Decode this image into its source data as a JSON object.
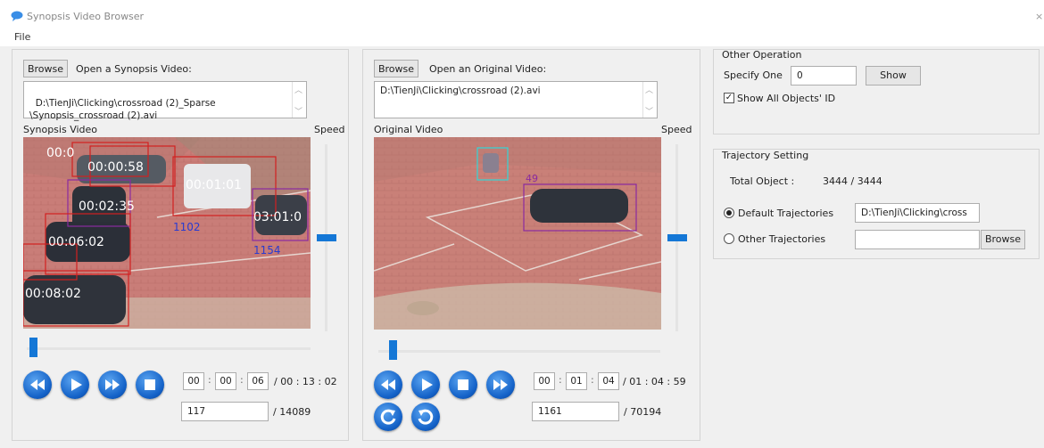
{
  "window": {
    "title": "Synopsis Video Browser",
    "close": "×"
  },
  "menu": {
    "file": "File"
  },
  "synopsis": {
    "browse_label": "Browse",
    "open_label": "Open a Synopsis Video:",
    "path": "D:\\TienJi\\Clicking\\crossroad (2)_Sparse\n\\Synopsis_crossroad (2).avi",
    "video_label": "Synopsis Video",
    "speed_label": "Speed",
    "speed_level": 0.5,
    "seek_fraction": 0.01,
    "time": {
      "hh": "00",
      "mm": "00",
      "ss": "06",
      "total": "/ 00 : 13 : 02"
    },
    "frame": {
      "current": "117",
      "total": "/ 14089"
    },
    "overlays": [
      {
        "text": "00:0",
        "color": "#ffffff"
      },
      {
        "text": "00:00:58",
        "color": "#ffffff"
      },
      {
        "text": "00:01:01",
        "color": "#ffffff"
      },
      {
        "text": "00:02:35",
        "color": "#ffffff"
      },
      {
        "text": "00:06:02",
        "color": "#ffffff"
      },
      {
        "text": "00:08:02",
        "color": "#ffffff"
      },
      {
        "text": "03:01:0",
        "color": "#ffffff"
      },
      {
        "text": "1102",
        "color": "#2a3bd0"
      },
      {
        "text": "1154",
        "color": "#2a3bd0"
      }
    ]
  },
  "original": {
    "browse_label": "Browse",
    "open_label": "Open an Original Video:",
    "path": "D:\\TienJi\\Clicking\\crossroad (2).avi",
    "video_label": "Original Video",
    "speed_label": "Speed",
    "speed_level": 0.5,
    "seek_fraction": 0.04,
    "time": {
      "hh": "00",
      "mm": "01",
      "ss": "04",
      "total": "/ 01 : 04 : 59"
    },
    "frame": {
      "current": "1161",
      "total": "/ 70194"
    },
    "overlays": [
      {
        "text": "49",
        "color": "#8a2aa0"
      }
    ]
  },
  "other_operation": {
    "title": "Other Operation",
    "specify_label": "Specify One",
    "specify_value": "0",
    "show_label": "Show",
    "show_all_label": "Show All Objects' ID",
    "show_all_checked": true
  },
  "trajectory": {
    "title": "Trajectory Setting",
    "total_label": "Total Object :",
    "total_value": "3444 / 3444",
    "default_label": "Default Trajectories",
    "default_path": "D:\\TienJi\\Clicking\\cross",
    "other_label": "Other Trajectories",
    "other_path": "",
    "browse_label": "Browse"
  },
  "colors": {
    "accent": "#1477d6",
    "box_red": "#d22020",
    "box_purple": "#8a2aa0",
    "box_cyan": "#32d6d6"
  }
}
